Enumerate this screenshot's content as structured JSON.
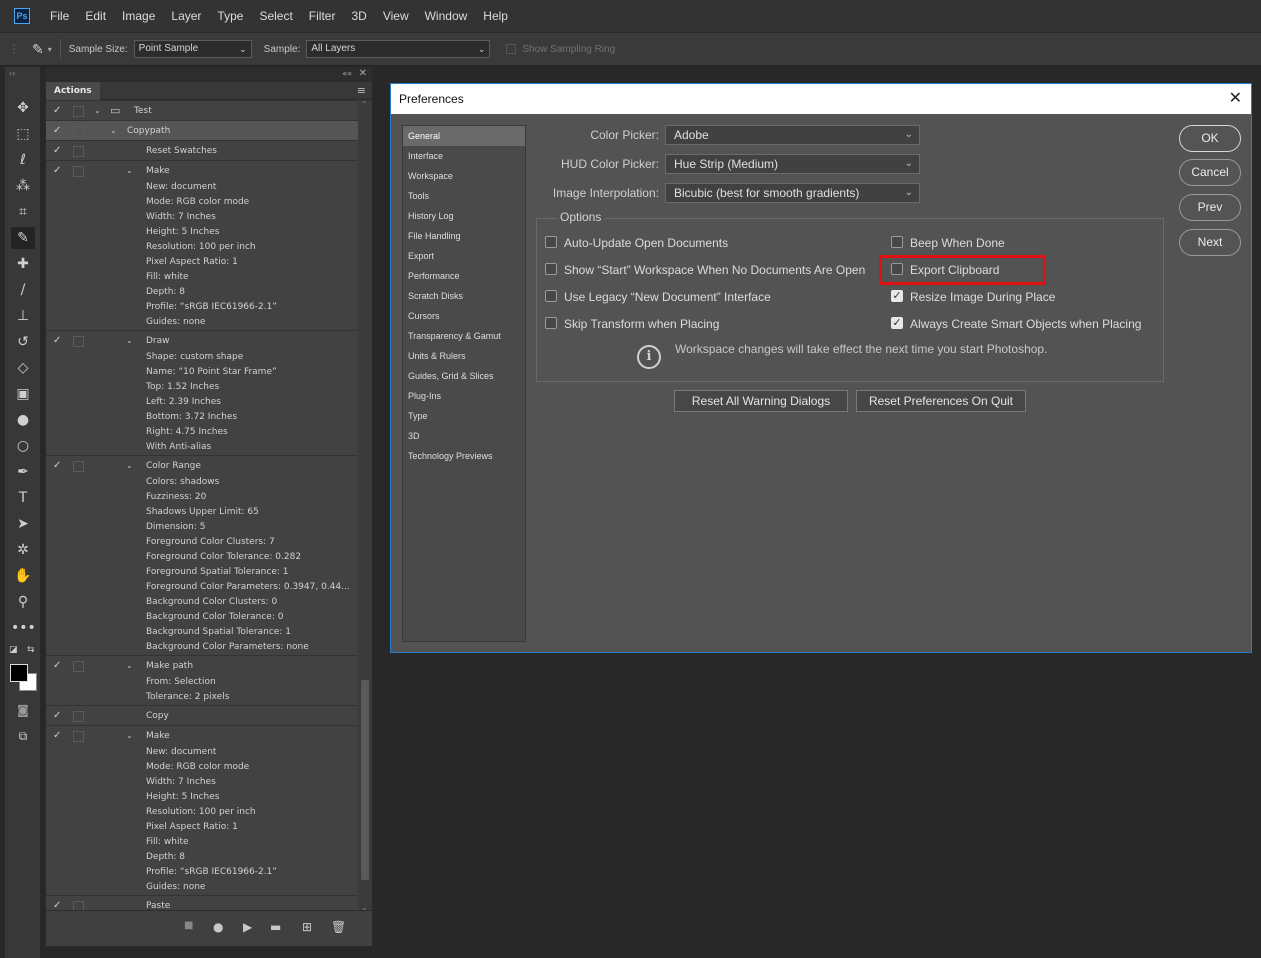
{
  "app": {
    "logo": "Ps"
  },
  "menu": [
    "File",
    "Edit",
    "Image",
    "Layer",
    "Type",
    "Select",
    "Filter",
    "3D",
    "View",
    "Window",
    "Help"
  ],
  "options_bar": {
    "sample_size_label": "Sample Size:",
    "sample_size_value": "Point Sample",
    "sample_label": "Sample:",
    "sample_value": "All Layers",
    "sampling_ring_label": "Show Sampling Ring"
  },
  "tools": [
    "move-icon",
    "marquee-icon",
    "lasso-icon",
    "magic-wand-icon",
    "crop-icon",
    "eyedropper-icon",
    "healing-brush-icon",
    "brush-icon",
    "stamp-icon",
    "history-brush-icon",
    "eraser-icon",
    "gradient-icon",
    "blur-icon",
    "dodge-icon",
    "pen-icon",
    "type-icon",
    "path-select-icon",
    "custom-shape-icon",
    "hand-icon",
    "zoom-icon",
    "more-tools-icon"
  ],
  "actions_panel": {
    "tab": "Actions",
    "rows": [
      {
        "text": "Test",
        "type": "set"
      },
      {
        "text": "Copypath",
        "type": "action"
      },
      {
        "text": "Reset Swatches",
        "type": "cmd"
      },
      {
        "text": "Make",
        "type": "cmd-exp"
      },
      {
        "text": "New: document",
        "type": "param"
      },
      {
        "text": "Mode: RGB color mode",
        "type": "param"
      },
      {
        "text": "Width: 7 Inches",
        "type": "param"
      },
      {
        "text": "Height: 5 Inches",
        "type": "param"
      },
      {
        "text": "Resolution: 100 per inch",
        "type": "param"
      },
      {
        "text": "Pixel Aspect Ratio: 1",
        "type": "param"
      },
      {
        "text": "Fill: white",
        "type": "param"
      },
      {
        "text": "Depth: 8",
        "type": "param"
      },
      {
        "text": "Profile:  “sRGB IEC61966-2.1”",
        "type": "param"
      },
      {
        "text": "Guides: none",
        "type": "param"
      },
      {
        "text": "Draw",
        "type": "cmd-exp"
      },
      {
        "text": "Shape: custom shape",
        "type": "param"
      },
      {
        "text": "Name:  “10 Point Star Frame”",
        "type": "param"
      },
      {
        "text": "Top: 1.52 Inches",
        "type": "param"
      },
      {
        "text": "Left: 2.39 Inches",
        "type": "param"
      },
      {
        "text": "Bottom: 3.72 Inches",
        "type": "param"
      },
      {
        "text": "Right: 4.75 Inches",
        "type": "param"
      },
      {
        "text": "With Anti-alias",
        "type": "param"
      },
      {
        "text": "Color Range",
        "type": "cmd-exp"
      },
      {
        "text": "Colors: shadows",
        "type": "param"
      },
      {
        "text": "Fuzziness: 20",
        "type": "param"
      },
      {
        "text": "Shadows Upper Limit: 65",
        "type": "param"
      },
      {
        "text": "Dimension: 5",
        "type": "param"
      },
      {
        "text": "Foreground Color Clusters: 7",
        "type": "param"
      },
      {
        "text": "Foreground Color Tolerance: 0.282",
        "type": "param"
      },
      {
        "text": "Foreground Spatial Tolerance: 1",
        "type": "param"
      },
      {
        "text": "Foreground Color Parameters: 0.3947, 0.44...",
        "type": "param"
      },
      {
        "text": "Background Color Clusters: 0",
        "type": "param"
      },
      {
        "text": "Background Color Tolerance: 0",
        "type": "param"
      },
      {
        "text": "Background Spatial Tolerance: 1",
        "type": "param"
      },
      {
        "text": "Background Color Parameters: none",
        "type": "param"
      },
      {
        "text": "Make path",
        "type": "cmd-exp"
      },
      {
        "text": "From: Selection",
        "type": "param"
      },
      {
        "text": "Tolerance: 2 pixels",
        "type": "param"
      },
      {
        "text": "Copy",
        "type": "cmd"
      },
      {
        "text": "Make",
        "type": "cmd-exp"
      },
      {
        "text": "New: document",
        "type": "param"
      },
      {
        "text": "Mode: RGB color mode",
        "type": "param"
      },
      {
        "text": "Width: 7 Inches",
        "type": "param"
      },
      {
        "text": "Height: 5 Inches",
        "type": "param"
      },
      {
        "text": "Resolution: 100 per inch",
        "type": "param"
      },
      {
        "text": "Pixel Aspect Ratio: 1",
        "type": "param"
      },
      {
        "text": "Fill: white",
        "type": "param"
      },
      {
        "text": "Depth: 8",
        "type": "param"
      },
      {
        "text": "Profile:  “sRGB IEC61966-2.1”",
        "type": "param"
      },
      {
        "text": "Guides: none",
        "type": "param"
      },
      {
        "text": "Paste",
        "type": "cmd"
      }
    ],
    "bottom_buttons": [
      "stop-icon",
      "record-icon",
      "play-icon",
      "new-set-icon",
      "new-action-icon",
      "delete-icon"
    ]
  },
  "preferences": {
    "title": "Preferences",
    "nav": [
      "General",
      "Interface",
      "Workspace",
      "Tools",
      "History Log",
      "File Handling",
      "Export",
      "Performance",
      "Scratch Disks",
      "Cursors",
      "Transparency & Gamut",
      "Units & Rulers",
      "Guides, Grid & Slices",
      "Plug-Ins",
      "Type",
      "3D",
      "Technology Previews"
    ],
    "selected_nav": "General",
    "color_picker_label": "Color Picker:",
    "color_picker_value": "Adobe",
    "hud_label": "HUD Color Picker:",
    "hud_value": "Hue Strip (Medium)",
    "interp_label": "Image Interpolation:",
    "interp_value": "Bicubic (best for smooth gradients)",
    "options_label": "Options",
    "options_left": [
      {
        "label": "Auto-Update Open Documents",
        "checked": false
      },
      {
        "label": "Show “Start” Workspace When No Documents Are Open",
        "checked": false
      },
      {
        "label": "Use Legacy “New Document” Interface",
        "checked": false
      },
      {
        "label": "Skip Transform when Placing",
        "checked": false
      }
    ],
    "options_right": [
      {
        "label": "Beep When Done",
        "checked": false
      },
      {
        "label": "Export Clipboard",
        "checked": false
      },
      {
        "label": "Resize Image During Place",
        "checked": true
      },
      {
        "label": "Always Create Smart Objects when Placing",
        "checked": true
      }
    ],
    "info_text": "Workspace changes will take effect the next time you start Photoshop.",
    "reset_warnings": "Reset All Warning Dialogs",
    "reset_prefs": "Reset Preferences On Quit",
    "buttons": {
      "ok": "OK",
      "cancel": "Cancel",
      "prev": "Prev",
      "next": "Next"
    },
    "highlight_color": "#e01111"
  }
}
